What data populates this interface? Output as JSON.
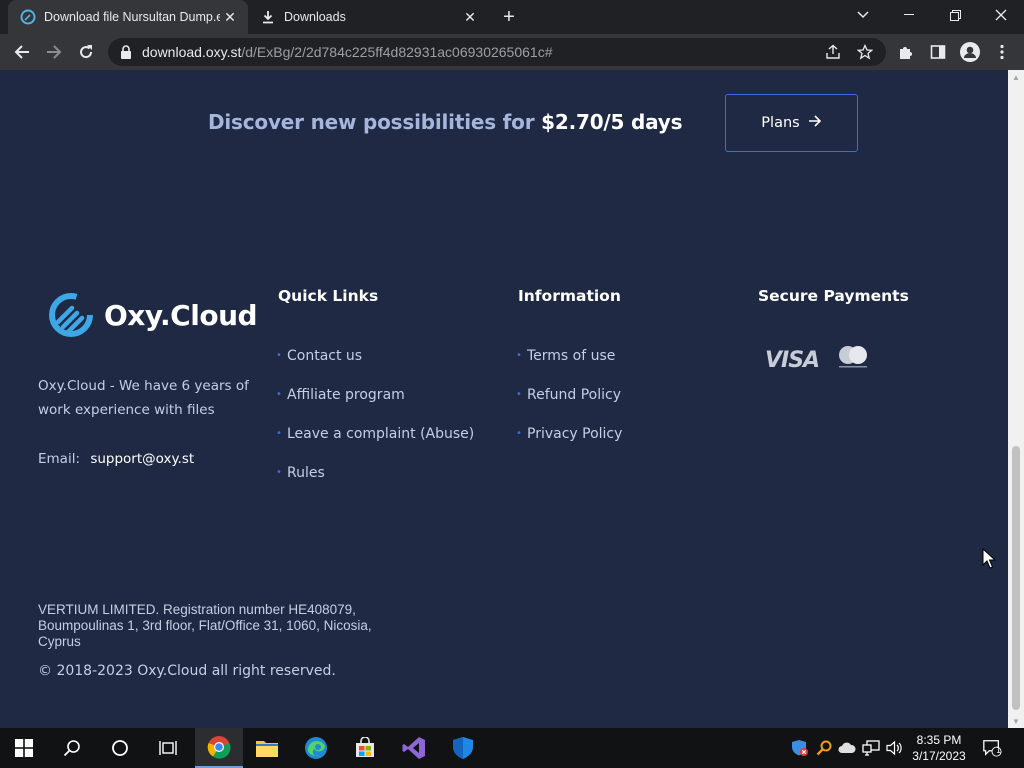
{
  "browser": {
    "tabs": [
      {
        "title": "Download file Nursultan Dump.e",
        "active": true
      },
      {
        "title": "Downloads",
        "active": false
      }
    ],
    "url_host": "download.oxy.st",
    "url_path": "/d/ExBg/2/2d784c225ff4d82931ac06930265061c#"
  },
  "promo": {
    "text": "Discover new possibilities for",
    "price": "$2.70/5 days",
    "plans_label": "Plans"
  },
  "footer": {
    "logo_text": "Oxy.Cloud",
    "about": "Oxy.Cloud - We have 6 years of work experience with files",
    "email_label": "Email:",
    "email_value": "support@oxy.st",
    "quick_links": {
      "title": "Quick Links",
      "items": [
        "Contact us",
        "Affiliate program",
        "Leave a complaint (Abuse)",
        "Rules"
      ]
    },
    "information": {
      "title": "Information",
      "items": [
        "Terms of use",
        "Refund Policy",
        "Privacy Policy"
      ]
    },
    "payments": {
      "title": "Secure Payments",
      "visa_text": "VISA",
      "mastercard_text": "mastercard"
    },
    "legal": "VERTIUM LIMITED. Registration number HE408079, Boumpoulinas 1, 3rd floor, Flat/Office 31, 1060, Nicosia, Cyprus",
    "copyright": "© 2018-2023  Oxy.Cloud all right reserved."
  },
  "taskbar": {
    "time": "8:35 PM",
    "date": "3/17/2023",
    "notification_count": "1"
  },
  "colors": {
    "page_bg": "#1f2944",
    "accent": "#3e6ae1",
    "promo_text": "#a5b5dc",
    "body_text": "#c6cee4"
  }
}
